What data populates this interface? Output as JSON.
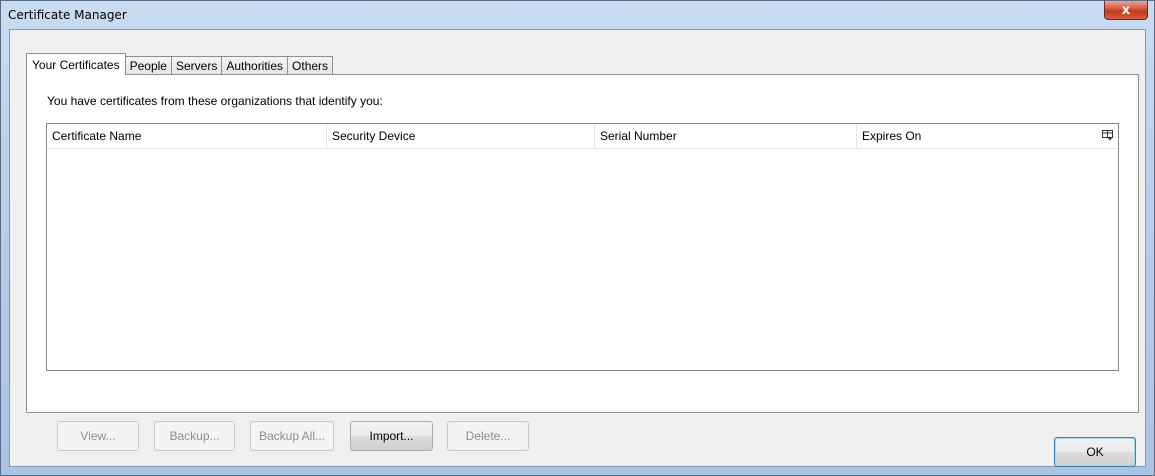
{
  "window": {
    "title": "Certificate Manager",
    "close_glyph": "x"
  },
  "tabs": [
    {
      "label": "Your Certificates",
      "active": true
    },
    {
      "label": "People",
      "active": false
    },
    {
      "label": "Servers",
      "active": false
    },
    {
      "label": "Authorities",
      "active": false
    },
    {
      "label": "Others",
      "active": false
    }
  ],
  "panel": {
    "intro_text": "You have certificates from these organizations that identify you:",
    "columns": [
      "Certificate Name",
      "Security Device",
      "Serial Number",
      "Expires On"
    ],
    "rows": []
  },
  "buttons": {
    "view": {
      "label": "View...",
      "enabled": false
    },
    "backup": {
      "label": "Backup...",
      "enabled": false
    },
    "backup_all": {
      "label": "Backup All...",
      "enabled": false
    },
    "import": {
      "label": "Import...",
      "enabled": true
    },
    "delete": {
      "label": "Delete...",
      "enabled": false
    }
  },
  "footer": {
    "ok_label": "OK"
  },
  "icons": {
    "column_picker": "column-picker-icon"
  }
}
